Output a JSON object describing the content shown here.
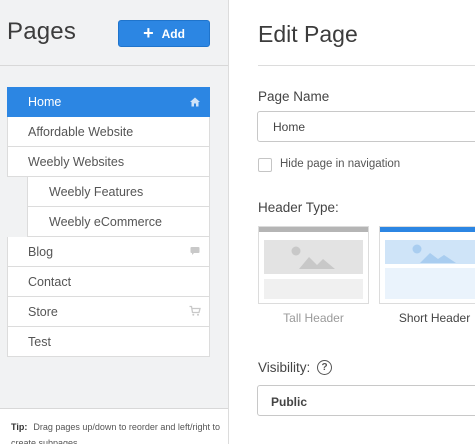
{
  "sidebar": {
    "title": "Pages",
    "add_label": "Add",
    "items": [
      {
        "label": "Home"
      },
      {
        "label": "Affordable Website"
      },
      {
        "label": "Weebly Websites"
      },
      {
        "label": "Weebly Features"
      },
      {
        "label": "Weebly eCommerce"
      },
      {
        "label": "Blog"
      },
      {
        "label": "Contact"
      },
      {
        "label": "Store"
      },
      {
        "label": "Test"
      }
    ],
    "tip_label": "Tip:",
    "tip_text": "Drag pages up/down to reorder and left/right to create subpages"
  },
  "editor": {
    "title": "Edit Page",
    "page_name_label": "Page Name",
    "page_name_value": "Home",
    "hide_nav_label": "Hide page in navigation",
    "header_type_label": "Header Type:",
    "header_options": [
      {
        "label": "Tall Header"
      },
      {
        "label": "Short Header"
      }
    ],
    "visibility_label": "Visibility:",
    "help_glyph": "?",
    "visibility_value": "Public"
  },
  "colors": {
    "accent": "#2c86e3",
    "sidebar_bg": "#f1f2f3"
  }
}
